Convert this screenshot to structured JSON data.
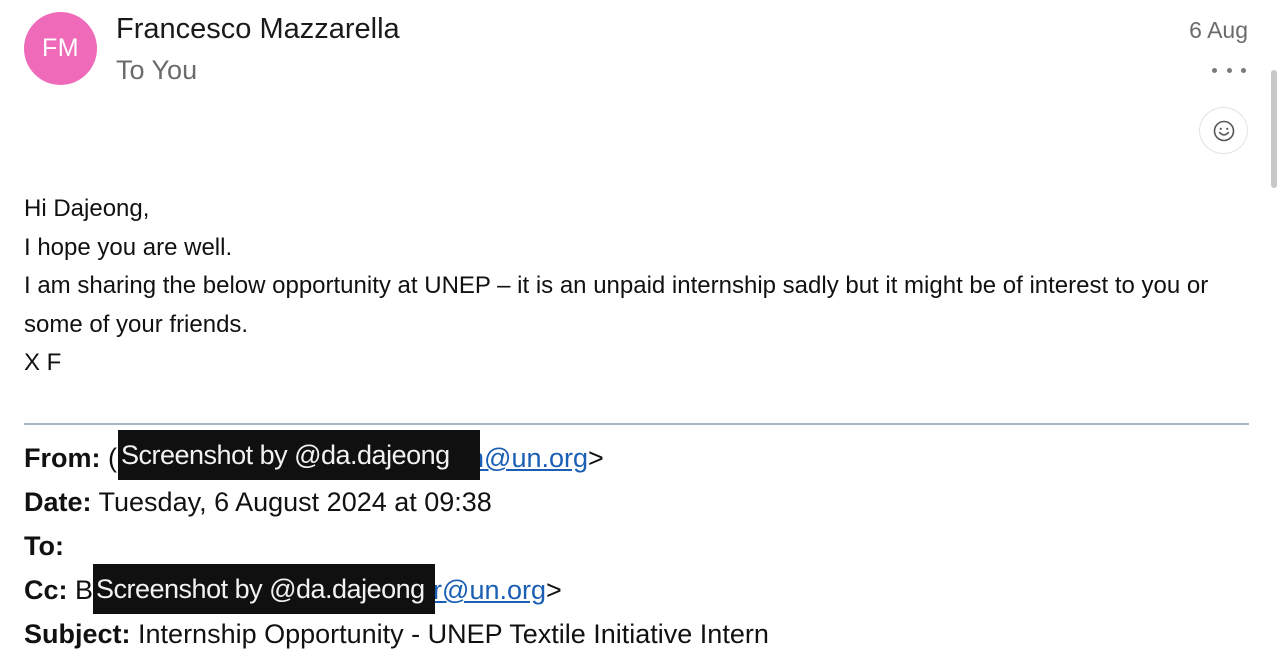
{
  "header": {
    "avatar_initials": "FM",
    "avatar_color": "#f06aba",
    "sender_name": "Francesco Mazzarella",
    "to_label": "To You",
    "date": "6 Aug",
    "more_icon": "more-horizontal-icon",
    "react_icon": "smiley-icon"
  },
  "body": {
    "lines": [
      "Hi Dajeong,",
      "I hope you are well.",
      "I am sharing the below opportunity at UNEP – it is an unpaid internship sadly but it might be of interest to you or some of your friends.",
      "X F"
    ]
  },
  "forwarded": {
    "from_label": "From:",
    "from_open": "(",
    "from_link": "n@un.org",
    "from_close": ">",
    "date_label": "Date:",
    "date_value": "Tuesday, 6 August 2024 at 09:38",
    "to_label": "To:",
    "cc_label": "Cc:",
    "cc_prefix": "B",
    "cc_link": "r@un.org",
    "cc_close": ">",
    "subject_label": "Subject:",
    "subject_value": "Internship Opportunity - UNEP Textile Initiative Intern",
    "redaction_text": "Screenshot by @da.dajeong"
  }
}
